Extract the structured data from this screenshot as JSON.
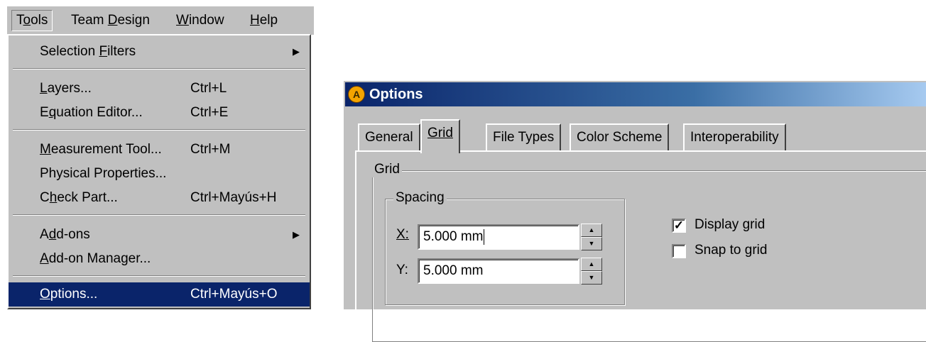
{
  "menubar": {
    "items": [
      {
        "pre": "T",
        "ul": "o",
        "post": "ols"
      },
      {
        "pre": "Team ",
        "ul": "D",
        "post": "esign"
      },
      {
        "pre": "",
        "ul": "W",
        "post": "indow"
      },
      {
        "pre": "",
        "ul": "H",
        "post": "elp"
      }
    ]
  },
  "menu": {
    "items": [
      {
        "pre": "Selection ",
        "ul": "F",
        "post": "ilters",
        "shortcut": "",
        "submenu": "▶"
      },
      {
        "pre": "",
        "ul": "L",
        "post": "ayers...",
        "shortcut": "Ctrl+L",
        "submenu": ""
      },
      {
        "pre": "E",
        "ul": "q",
        "post": "uation Editor...",
        "shortcut": "Ctrl+E",
        "submenu": ""
      },
      {
        "pre": "",
        "ul": "M",
        "post": "easurement Tool...",
        "shortcut": "Ctrl+M",
        "submenu": ""
      },
      {
        "pre": "Physical Properties...",
        "ul": "",
        "post": "",
        "shortcut": "",
        "submenu": ""
      },
      {
        "pre": "C",
        "ul": "h",
        "post": "eck Part...",
        "shortcut": "Ctrl+Mayús+H",
        "submenu": ""
      },
      {
        "pre": "A",
        "ul": "d",
        "post": "d-ons",
        "shortcut": "",
        "submenu": "▶"
      },
      {
        "pre": "",
        "ul": "A",
        "post": "dd-on Manager...",
        "shortcut": "",
        "submenu": ""
      },
      {
        "pre": "",
        "ul": "O",
        "post": "ptions...",
        "shortcut": "Ctrl+Mayús+O",
        "submenu": ""
      }
    ]
  },
  "dialog": {
    "title": "Options",
    "tabs": [
      "General",
      "Grid",
      "File Types",
      "Color Scheme",
      "Interoperability"
    ],
    "active_tab": "Grid",
    "grid_group": "Grid",
    "spacing_group": "Spacing",
    "x_label": "X:",
    "x_value": "5.000 mm",
    "y_label": "Y:",
    "y_value": "5.000 mm",
    "display_grid": {
      "label": "Display grid",
      "checked": true,
      "mark": "✓"
    },
    "snap_to_grid": {
      "label": "Snap to grid",
      "checked": false,
      "mark": ""
    }
  },
  "icons": {
    "spin_up": "▲",
    "spin_down": "▼",
    "submenu": "▶"
  }
}
